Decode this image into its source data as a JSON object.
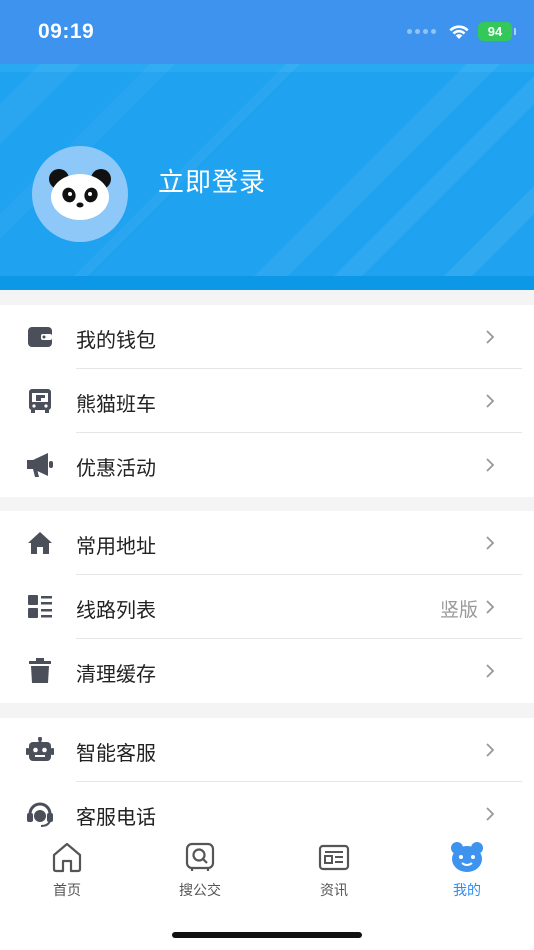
{
  "status_bar": {
    "time": "09:19",
    "battery": "94"
  },
  "header": {
    "login_text": "立即登录"
  },
  "colors": {
    "accent": "#2e8ef0",
    "header_bg": "#1fa2f0",
    "status_bg": "#3d93ee",
    "icon": "#4a4f5a"
  },
  "groups": [
    {
      "items": [
        {
          "label": "我的钱包",
          "icon": "wallet-icon"
        },
        {
          "label": "熊猫班车",
          "icon": "bus-icon"
        },
        {
          "label": "优惠活动",
          "icon": "megaphone-icon"
        }
      ]
    },
    {
      "items": [
        {
          "label": "常用地址",
          "icon": "home-icon"
        },
        {
          "label": "线路列表",
          "icon": "list-icon",
          "value": "竖版"
        },
        {
          "label": "清理缓存",
          "icon": "trash-icon"
        }
      ]
    },
    {
      "items": [
        {
          "label": "智能客服",
          "icon": "robot-icon"
        },
        {
          "label": "客服电话",
          "icon": "headset-icon"
        }
      ]
    }
  ],
  "tabs": [
    {
      "label": "首页",
      "icon": "home-tab-icon",
      "active": false
    },
    {
      "label": "搜公交",
      "icon": "search-bus-icon",
      "active": false
    },
    {
      "label": "资讯",
      "icon": "news-icon",
      "active": false
    },
    {
      "label": "我的",
      "icon": "bear-icon",
      "active": true
    }
  ]
}
